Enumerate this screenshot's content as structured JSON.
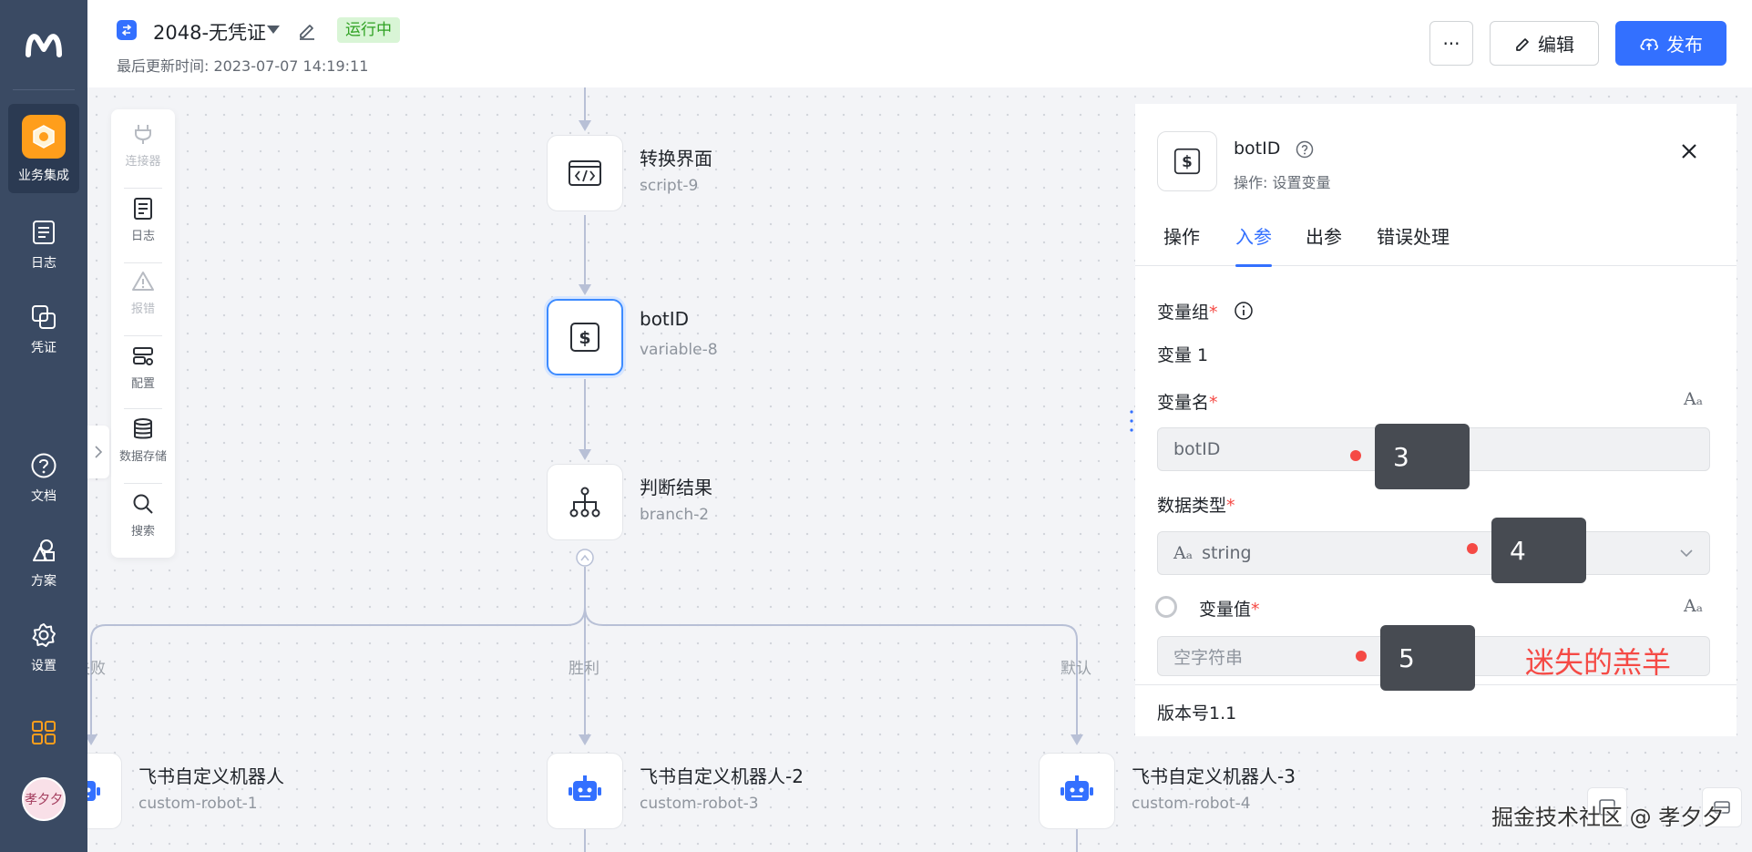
{
  "nav": {
    "items": [
      {
        "label": "业务集成",
        "icon": "integration-icon"
      },
      {
        "label": "日志",
        "icon": "log-icon"
      },
      {
        "label": "凭证",
        "icon": "credential-icon"
      },
      {
        "label": "文档",
        "icon": "help-circle-icon"
      },
      {
        "label": "方案",
        "icon": "solution-icon"
      },
      {
        "label": "设置",
        "icon": "gear-icon"
      }
    ],
    "avatar_text": "孝夕夕"
  },
  "header": {
    "title": "2048-无凭证",
    "status": "运行中",
    "updated": "最后更新时间: 2023-07-07 14:19:11",
    "more_label": "···",
    "edit_label": "编辑",
    "publish_label": "发布"
  },
  "toolbar": {
    "items": [
      {
        "label": "连接器",
        "icon": "plug-icon",
        "enabled": false
      },
      {
        "label": "日志",
        "icon": "document-icon",
        "enabled": true
      },
      {
        "label": "报错",
        "icon": "warning-icon",
        "enabled": false
      },
      {
        "label": "配置",
        "icon": "config-icon",
        "enabled": true
      },
      {
        "label": "数据存储",
        "icon": "database-icon",
        "enabled": true
      },
      {
        "label": "搜索",
        "icon": "search-icon",
        "enabled": true
      }
    ]
  },
  "flow": {
    "nodes": [
      {
        "title": "转换界面",
        "sub": "script-9",
        "icon": "code-icon"
      },
      {
        "title": "botID",
        "sub": "variable-8",
        "icon": "dollar-icon"
      },
      {
        "title": "判断结果",
        "sub": "branch-2",
        "icon": "branch-icon"
      },
      {
        "title": "飞书自定义机器人",
        "sub": "custom-robot-1",
        "icon": "robot-icon"
      },
      {
        "title": "飞书自定义机器人-2",
        "sub": "custom-robot-3",
        "icon": "robot-icon"
      },
      {
        "title": "飞书自定义机器人-3",
        "sub": "custom-robot-4",
        "icon": "robot-icon"
      }
    ],
    "branch_labels": [
      "失败",
      "胜利",
      "默认"
    ]
  },
  "panel": {
    "title": "botID",
    "subtitle": "操作: 设置变量",
    "tabs": [
      "操作",
      "入参",
      "出参",
      "错误处理"
    ],
    "active_tab": 1,
    "variable_group_label": "变量组",
    "variable_item": "变量 1",
    "name_label": "变量名",
    "name_value": "botID",
    "type_label": "数据类型",
    "type_value": "string",
    "type_prefix": "Aₐ",
    "value_label": "变量值",
    "value_placeholder": "空字符串",
    "aa_glyph": "Aₐ",
    "required_mark": "*",
    "version": "版本号1.1"
  },
  "callouts": [
    "3",
    "4",
    "5"
  ],
  "annotation": "迷失的羔羊",
  "watermark": "掘金技术社区 @ 孝夕夕",
  "colors": {
    "nav_bg": "#3a4a63",
    "primary": "#3370ff",
    "accent_orange": "#ff9e1b",
    "status_green": "#2ea121",
    "callout_bg": "#474b52",
    "required_red": "#f54a45"
  }
}
